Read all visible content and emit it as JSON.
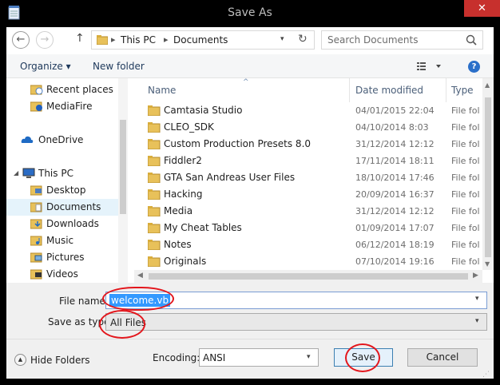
{
  "window": {
    "title": "Save As",
    "close_glyph": "✕",
    "app_icon": "notepad-icon"
  },
  "navigation": {
    "back_glyph": "←",
    "forward_glyph": "→",
    "up_glyph": "↑",
    "breadcrumb": [
      "This PC",
      "Documents"
    ],
    "breadcrumb_sep": "▸",
    "refresh_glyph": "↻",
    "dropdown_glyph": "▾",
    "search_placeholder": "Search Documents"
  },
  "command_bar": {
    "organize_label": "Organize ▾",
    "new_folder_label": "New folder",
    "help_glyph": "?"
  },
  "nav_pane": {
    "items": [
      {
        "label": "Recent places",
        "icon": "recent-places-icon"
      },
      {
        "label": "MediaFire",
        "icon": "mediafire-icon"
      },
      {
        "label": "OneDrive",
        "icon": "onedrive-icon"
      },
      {
        "label": "This PC",
        "icon": "computer-icon"
      },
      {
        "label": "Desktop",
        "icon": "folder-icon"
      },
      {
        "label": "Documents",
        "icon": "folder-icon",
        "selected": true
      },
      {
        "label": "Downloads",
        "icon": "folder-icon"
      },
      {
        "label": "Music",
        "icon": "folder-icon"
      },
      {
        "label": "Pictures",
        "icon": "folder-icon"
      },
      {
        "label": "Videos",
        "icon": "folder-icon"
      }
    ]
  },
  "file_list": {
    "columns": [
      "Name",
      "Date modified",
      "Type"
    ],
    "sort_glyph": "^",
    "rows": [
      {
        "name": "Camtasia Studio",
        "date": "04/01/2015 22:04",
        "type": "File fol"
      },
      {
        "name": "CLEO_SDK",
        "date": "04/10/2014 8:03",
        "type": "File fol"
      },
      {
        "name": "Custom Production Presets 8.0",
        "date": "31/12/2014 12:12",
        "type": "File fol"
      },
      {
        "name": "Fiddler2",
        "date": "17/11/2014 18:11",
        "type": "File fol"
      },
      {
        "name": "GTA San Andreas User Files",
        "date": "18/10/2014 17:46",
        "type": "File fol"
      },
      {
        "name": "Hacking",
        "date": "20/09/2014 16:37",
        "type": "File fol"
      },
      {
        "name": "Media",
        "date": "31/12/2014 12:12",
        "type": "File fol"
      },
      {
        "name": "My Cheat Tables",
        "date": "01/09/2014 17:07",
        "type": "File fol"
      },
      {
        "name": "Notes",
        "date": "06/12/2014 18:19",
        "type": "File fol"
      },
      {
        "name": "Originals",
        "date": "07/10/2014 19:16",
        "type": "File fol"
      }
    ]
  },
  "form": {
    "filename_label": "File name:",
    "filename_value": "welcome.vbs",
    "savetype_label": "Save as type:",
    "savetype_value": "All Files",
    "hide_folders_label": "Hide Folders",
    "encoding_label": "Encoding:",
    "encoding_value": "ANSI",
    "save_label": "Save",
    "cancel_label": "Cancel"
  },
  "colors": {
    "close_red": "#c7302d",
    "selection_blue": "#3399ff",
    "annotation_red": "#e3161c"
  }
}
